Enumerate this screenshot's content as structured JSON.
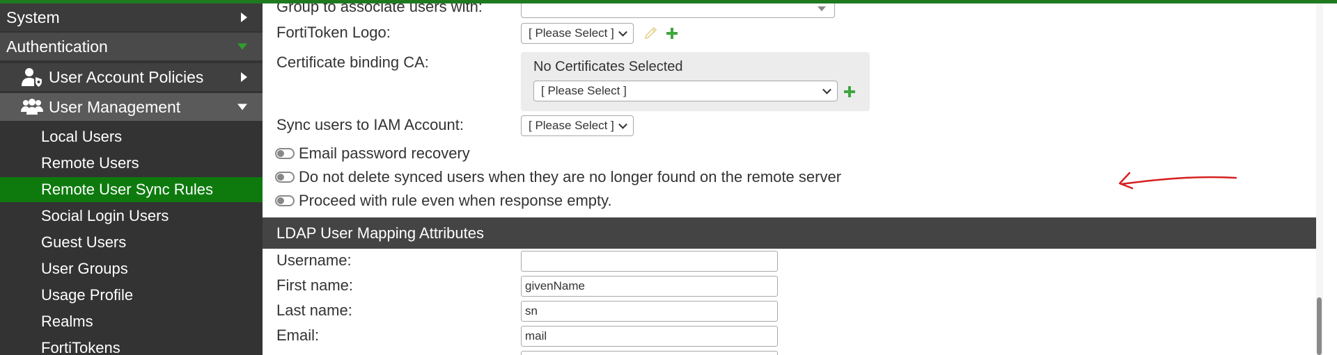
{
  "sidebar": {
    "system": "System",
    "authentication": "Authentication",
    "user_account_policies": "User Account Policies",
    "user_management": "User Management",
    "items": [
      {
        "label": "Local Users"
      },
      {
        "label": "Remote Users"
      },
      {
        "label": "Remote User Sync Rules"
      },
      {
        "label": "Social Login Users"
      },
      {
        "label": "Guest Users"
      },
      {
        "label": "User Groups"
      },
      {
        "label": "Usage Profile"
      },
      {
        "label": "Realms"
      },
      {
        "label": "FortiTokens"
      }
    ],
    "active_item": "Remote User Sync Rules"
  },
  "form": {
    "group_label": "Group to associate users with:",
    "fortitoken_logo_label": "FortiToken Logo:",
    "fortitoken_logo_value": "[ Please Select ]",
    "cert_ca_label": "Certificate binding CA:",
    "cert_none_text": "No Certificates Selected",
    "cert_select_value": "[ Please Select ]",
    "sync_iam_label": "Sync users to IAM Account:",
    "sync_iam_value": "[ Please Select ]",
    "toggles": [
      {
        "label": "Email password recovery",
        "on": false
      },
      {
        "label": "Do not delete synced users when they are no longer found on the remote server",
        "on": false
      },
      {
        "label": "Proceed with rule even when response empty.",
        "on": false
      }
    ]
  },
  "ldap": {
    "header": "LDAP User Mapping Attributes",
    "username_label": "Username:",
    "username_value": "",
    "first_name_label": "First name:",
    "first_name_value": "givenName",
    "last_name_label": "Last name:",
    "last_name_value": "sn",
    "email_label": "Email:",
    "email_value": "mail"
  },
  "colors": {
    "top_bar": "#1f7a1f",
    "sidebar_bg": "#333333",
    "active_item": "#0e7a0e",
    "section_header": "#444444",
    "plus_icon": "#3fa63f",
    "annotation": "#d62020"
  },
  "icons": {
    "user_account_policies": "user-shield-icon",
    "user_management": "users-group-icon",
    "edit": "pencil-icon",
    "add": "plus-icon"
  }
}
